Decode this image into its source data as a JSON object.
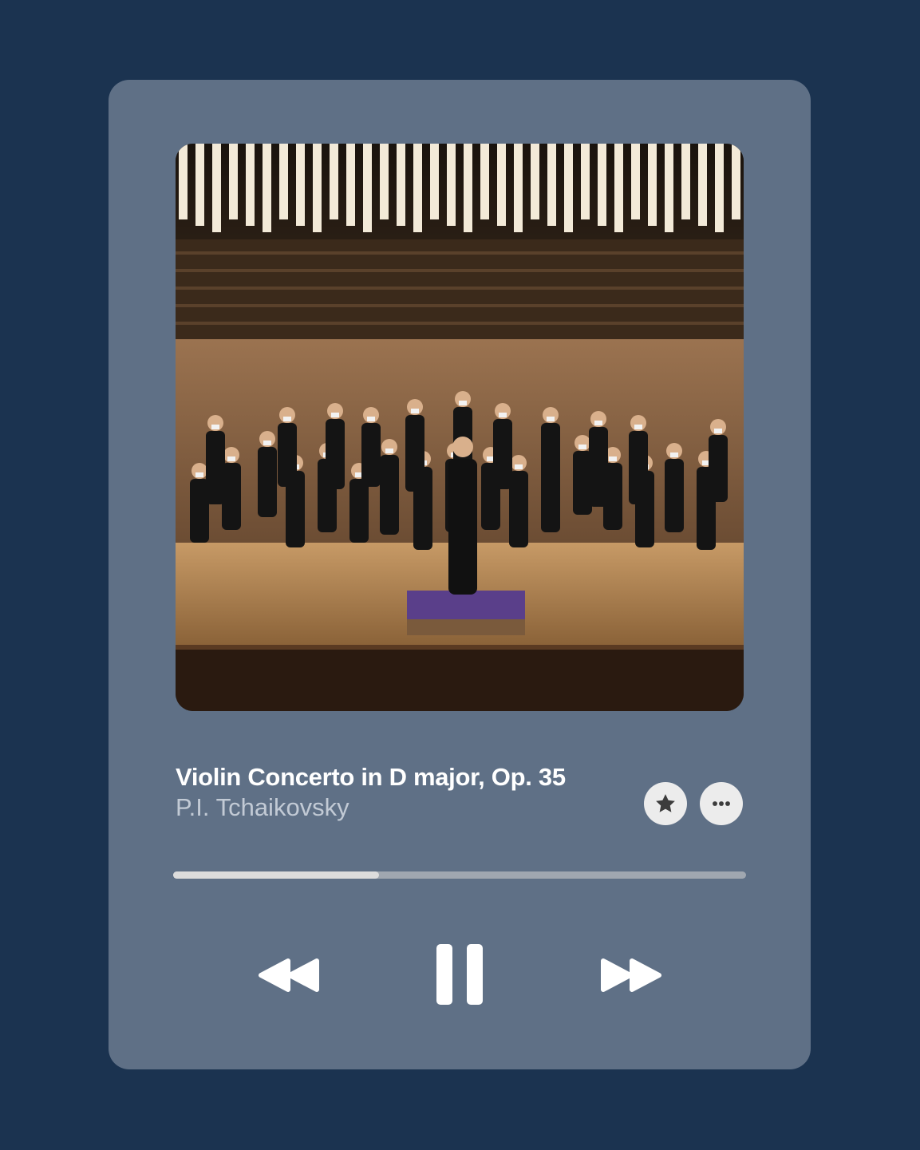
{
  "track": {
    "title": "Violin Concerto in D major, Op. 35",
    "artist": "P.I. Tchaikovsky"
  },
  "artwork": {
    "description": "orchestra-on-stage-photo"
  },
  "actions": {
    "favorite_icon": "star-icon",
    "more_icon": "ellipsis-icon"
  },
  "playback": {
    "progress_fraction": 0.36,
    "state": "playing"
  },
  "controls": {
    "previous_icon": "rewind-icon",
    "play_pause_icon": "pause-icon",
    "next_icon": "fast-forward-icon"
  },
  "colors": {
    "background": "#1b3350",
    "card": "#5f7086",
    "progress_track": "#a0a7b0",
    "progress_fill": "#dcdcdc",
    "button": "#ececec",
    "icon_dark": "#3c3c3c"
  }
}
